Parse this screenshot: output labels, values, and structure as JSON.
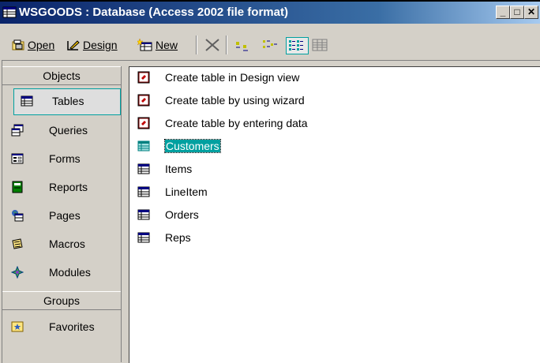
{
  "window": {
    "title": "WSGOODS : Database (Access 2002 file format)",
    "controls": [
      "_",
      "□",
      "✕"
    ]
  },
  "toolbar": {
    "open": "Open",
    "design": "Design",
    "new": "New"
  },
  "left": {
    "objects_header": "Objects",
    "groups_header": "Groups",
    "items": [
      {
        "label": "Tables",
        "icon": "table-icon"
      },
      {
        "label": "Queries",
        "icon": "query-icon"
      },
      {
        "label": "Forms",
        "icon": "form-icon"
      },
      {
        "label": "Reports",
        "icon": "report-icon"
      },
      {
        "label": "Pages",
        "icon": "page-icon"
      },
      {
        "label": "Macros",
        "icon": "macro-icon"
      },
      {
        "label": "Modules",
        "icon": "module-icon"
      }
    ],
    "group_items": [
      {
        "label": "Favorites",
        "icon": "favorites-icon"
      }
    ]
  },
  "list": {
    "items": [
      {
        "label": "Create table in Design view",
        "icon": "shortcut-icon"
      },
      {
        "label": "Create table by using wizard",
        "icon": "shortcut-icon"
      },
      {
        "label": "Create table by entering data",
        "icon": "shortcut-icon"
      },
      {
        "label": "Customers",
        "icon": "table-icon"
      },
      {
        "label": "Items",
        "icon": "table-icon"
      },
      {
        "label": "LineItem",
        "icon": "table-icon"
      },
      {
        "label": "Orders",
        "icon": "table-icon"
      },
      {
        "label": "Reps",
        "icon": "table-icon"
      }
    ],
    "selected": "Customers"
  }
}
